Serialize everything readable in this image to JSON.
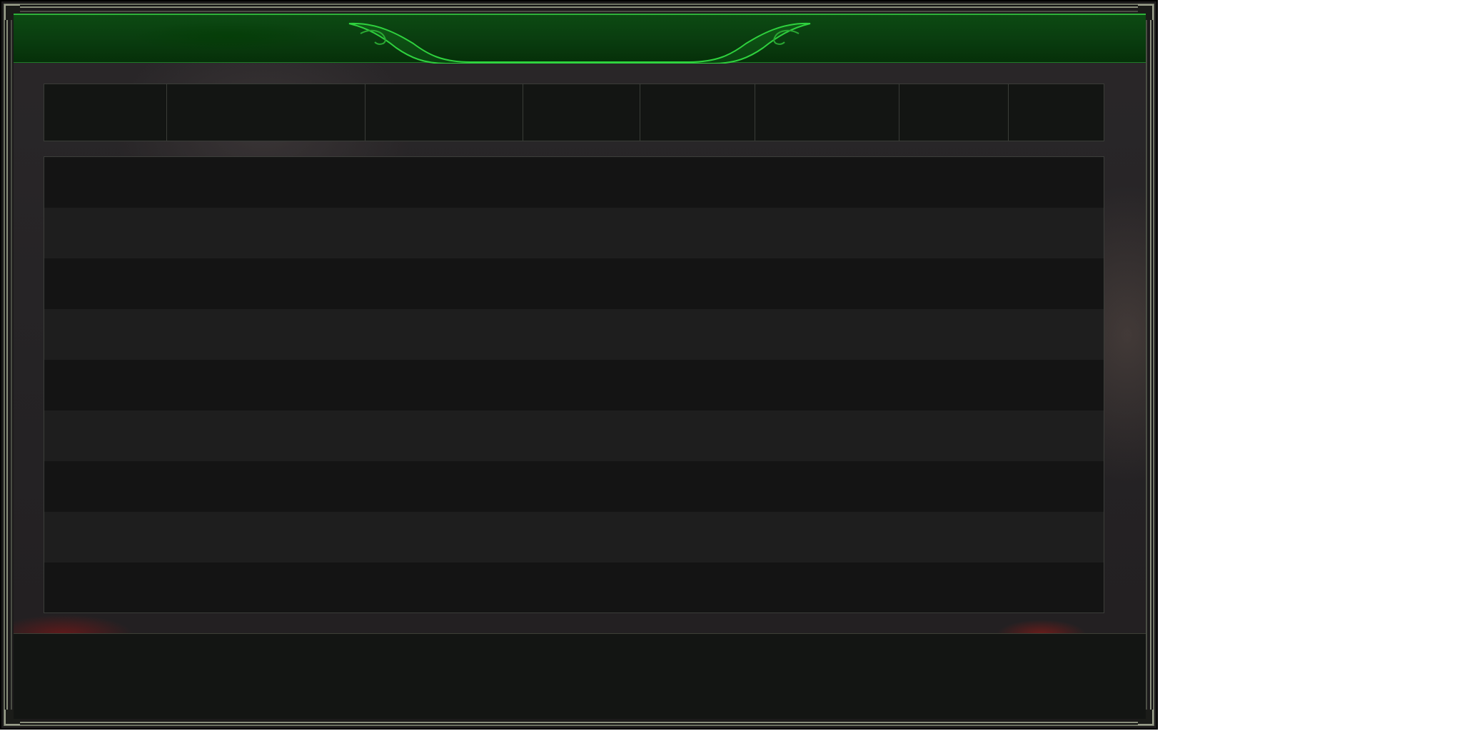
{
  "window": {
    "title": ""
  },
  "header": {
    "title": "",
    "accent_color": "#2fb33a"
  },
  "columns": [
    {
      "label": ""
    },
    {
      "label": ""
    },
    {
      "label": ""
    },
    {
      "label": ""
    },
    {
      "label": ""
    },
    {
      "label": ""
    },
    {
      "label": ""
    },
    {
      "label": ""
    }
  ],
  "table": {
    "rows": [
      {
        "cells": []
      },
      {
        "cells": []
      },
      {
        "cells": []
      },
      {
        "cells": []
      },
      {
        "cells": []
      },
      {
        "cells": []
      },
      {
        "cells": []
      },
      {
        "cells": []
      },
      {
        "cells": []
      }
    ]
  },
  "footer": {
    "text": ""
  },
  "colors": {
    "banner_green": "#0a3f10",
    "frame": "#8a8f7c",
    "row_dark": "#141414",
    "row_light": "#1e1e1e"
  }
}
